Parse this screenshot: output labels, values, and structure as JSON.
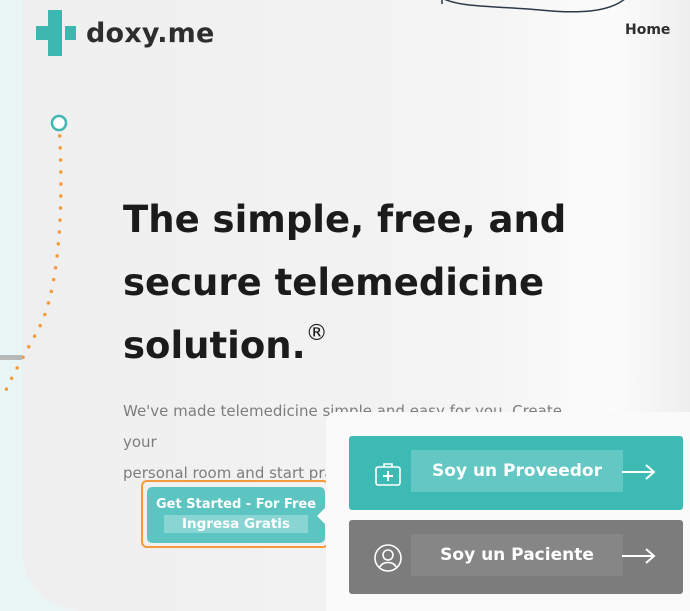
{
  "brand": {
    "name": "doxy.me",
    "color": "#3fb7b1"
  },
  "nav": {
    "home_label": "Home"
  },
  "hero": {
    "line1": "The simple, free, and",
    "line2": "secure telemedicine",
    "line3": "solution.",
    "mark": "®"
  },
  "subtext": {
    "line1": "We've made telemedicine simple and easy for you. Create your",
    "line2": "personal room and start pra"
  },
  "cta": {
    "line1": "Get Started - For Free",
    "line2": "Ingresa Gratis"
  },
  "roles": {
    "provider": {
      "label": "Soy un Proveedor",
      "icon": "medical-bag-icon",
      "color": "#3dbab4"
    },
    "patient": {
      "label": "Soy un Paciente",
      "icon": "user-icon",
      "color": "#7c7c7c"
    }
  },
  "accent_orange": "#f39a3a"
}
